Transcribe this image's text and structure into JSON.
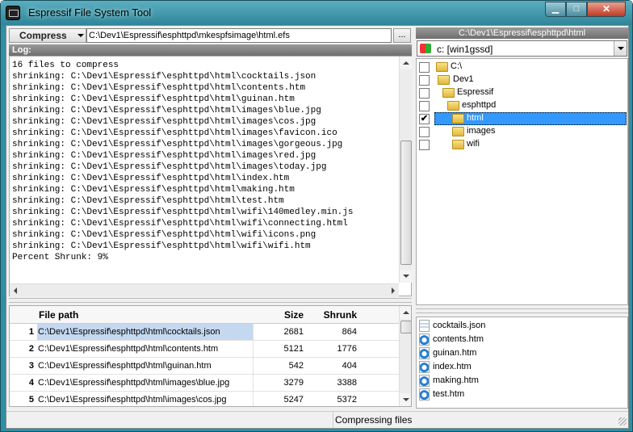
{
  "window": {
    "title": "Espressif File System Tool",
    "min_label": "▁",
    "max_label": "□",
    "close_label": "✕"
  },
  "toolbar": {
    "compress_label": "Compress",
    "path_value": "C:\\Dev1\\Espressif\\esphttpd\\mkespfsimage\\html.efs",
    "browse_label": "..."
  },
  "log": {
    "header": "Log:",
    "text": "16 files to compress\nshrinking: C:\\Dev1\\Espressif\\esphttpd\\html\\cocktails.json\nshrinking: C:\\Dev1\\Espressif\\esphttpd\\html\\contents.htm\nshrinking: C:\\Dev1\\Espressif\\esphttpd\\html\\guinan.htm\nshrinking: C:\\Dev1\\Espressif\\esphttpd\\html\\images\\blue.jpg\nshrinking: C:\\Dev1\\Espressif\\esphttpd\\html\\images\\cos.jpg\nshrinking: C:\\Dev1\\Espressif\\esphttpd\\html\\images\\favicon.ico\nshrinking: C:\\Dev1\\Espressif\\esphttpd\\html\\images\\gorgeous.jpg\nshrinking: C:\\Dev1\\Espressif\\esphttpd\\html\\images\\red.jpg\nshrinking: C:\\Dev1\\Espressif\\esphttpd\\html\\images\\today.jpg\nshrinking: C:\\Dev1\\Espressif\\esphttpd\\html\\index.htm\nshrinking: C:\\Dev1\\Espressif\\esphttpd\\html\\making.htm\nshrinking: C:\\Dev1\\Espressif\\esphttpd\\html\\test.htm\nshrinking: C:\\Dev1\\Espressif\\esphttpd\\html\\wifi\\140medley.min.js\nshrinking: C:\\Dev1\\Espressif\\esphttpd\\html\\wifi\\connecting.html\nshrinking: C:\\Dev1\\Espressif\\esphttpd\\html\\wifi\\icons.png\nshrinking: C:\\Dev1\\Espressif\\esphttpd\\html\\wifi\\wifi.htm\nPercent Shrunk: 9%"
  },
  "table": {
    "headers": {
      "path": "File path",
      "size": "Size",
      "shrunk": "Shrunk"
    },
    "rows": [
      {
        "num": "1",
        "path": "C:\\Dev1\\Espressif\\esphttpd\\html\\cocktails.json",
        "size": "2681",
        "shrunk": "864"
      },
      {
        "num": "2",
        "path": "C:\\Dev1\\Espressif\\esphttpd\\html\\contents.htm",
        "size": "5121",
        "shrunk": "1776"
      },
      {
        "num": "3",
        "path": "C:\\Dev1\\Espressif\\esphttpd\\html\\guinan.htm",
        "size": "542",
        "shrunk": "404"
      },
      {
        "num": "4",
        "path": "C:\\Dev1\\Espressif\\esphttpd\\html\\images\\blue.jpg",
        "size": "3279",
        "shrunk": "3388"
      },
      {
        "num": "5",
        "path": "C:\\Dev1\\Espressif\\esphttpd\\html\\images\\cos.jpg",
        "size": "5247",
        "shrunk": "5372"
      }
    ]
  },
  "status": {
    "text": "Compressing files"
  },
  "folder_panel": {
    "header": "C:\\Dev1\\Espressif\\esphttpd\\html",
    "drive": "c: [win1gssd]",
    "tree": [
      {
        "label": "C:\\",
        "checked": ""
      },
      {
        "label": "Dev1",
        "checked": ""
      },
      {
        "label": "Espressif",
        "checked": ""
      },
      {
        "label": "esphttpd",
        "checked": ""
      },
      {
        "label": "html",
        "checked": "✔"
      },
      {
        "label": "images",
        "checked": ""
      },
      {
        "label": "wifi",
        "checked": ""
      }
    ],
    "files": [
      {
        "label": "cocktails.json",
        "icon": "json-file-icon"
      },
      {
        "label": "contents.htm",
        "icon": "html-file-icon"
      },
      {
        "label": "guinan.htm",
        "icon": "html-file-icon"
      },
      {
        "label": "index.htm",
        "icon": "html-file-icon"
      },
      {
        "label": "making.htm",
        "icon": "html-file-icon"
      },
      {
        "label": "test.htm",
        "icon": "html-file-icon"
      }
    ]
  },
  "colors": {
    "selection": "#3399ff",
    "row_selection": "#c4d9f0",
    "title_bar": "#2f8fa4"
  }
}
